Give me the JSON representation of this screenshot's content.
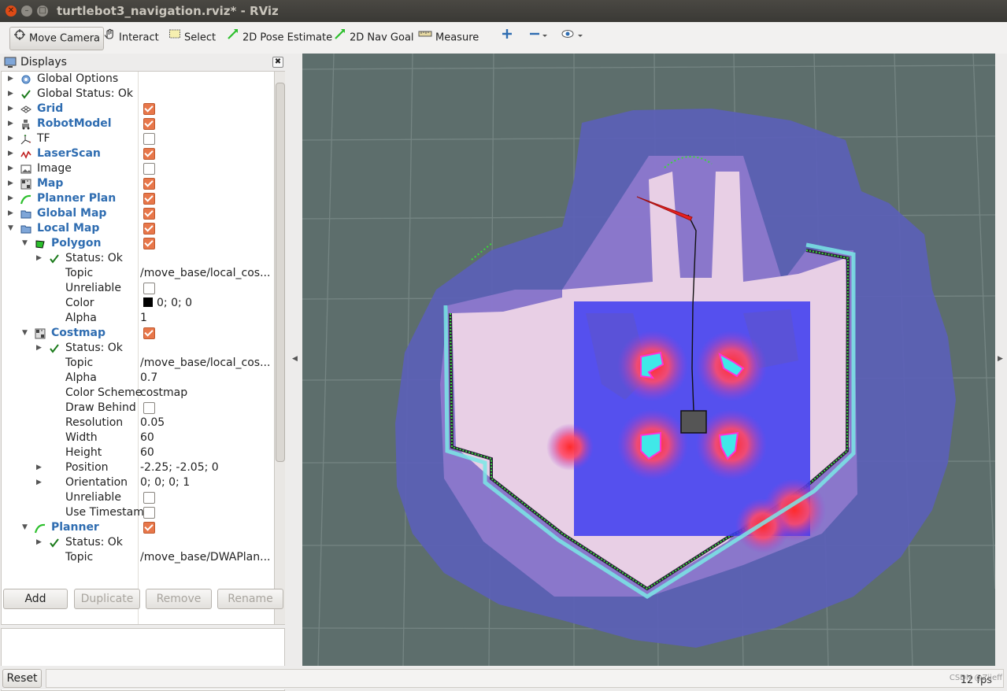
{
  "window": {
    "title": "turtlebot3_navigation.rviz* - RViz"
  },
  "toolbar": {
    "move_camera": "Move Camera",
    "interact": "Interact",
    "select": "Select",
    "pose_estimate": "2D Pose Estimate",
    "nav_goal": "2D Nav Goal",
    "measure": "Measure"
  },
  "displays": {
    "title": "Displays",
    "rows": [
      {
        "indent": 0,
        "arrow": "right",
        "icon": "gear-icon",
        "name": "Global Options",
        "blue": false,
        "check": null,
        "value": ""
      },
      {
        "indent": 0,
        "arrow": "right",
        "icon": "check-icon",
        "name": "Global Status: Ok",
        "blue": false,
        "check": null,
        "value": ""
      },
      {
        "indent": 0,
        "arrow": "right",
        "icon": "grid-icon",
        "name": "Grid",
        "blue": true,
        "check": true,
        "value": ""
      },
      {
        "indent": 0,
        "arrow": "right",
        "icon": "robot-icon",
        "name": "RobotModel",
        "blue": true,
        "check": true,
        "value": ""
      },
      {
        "indent": 0,
        "arrow": "right",
        "icon": "tf-icon",
        "name": "TF",
        "blue": false,
        "check": false,
        "value": ""
      },
      {
        "indent": 0,
        "arrow": "right",
        "icon": "laser-icon",
        "name": "LaserScan",
        "blue": true,
        "check": true,
        "value": ""
      },
      {
        "indent": 0,
        "arrow": "right",
        "icon": "image-icon",
        "name": "Image",
        "blue": false,
        "check": false,
        "value": ""
      },
      {
        "indent": 0,
        "arrow": "right",
        "icon": "map-icon",
        "name": "Map",
        "blue": true,
        "check": true,
        "value": ""
      },
      {
        "indent": 0,
        "arrow": "right",
        "icon": "path-icon",
        "name": "Planner Plan",
        "blue": true,
        "check": true,
        "value": ""
      },
      {
        "indent": 0,
        "arrow": "right",
        "icon": "folder-icon",
        "name": "Global Map",
        "blue": true,
        "check": true,
        "value": ""
      },
      {
        "indent": 0,
        "arrow": "down",
        "icon": "folder-icon",
        "name": "Local Map",
        "blue": true,
        "check": true,
        "value": ""
      },
      {
        "indent": 1,
        "arrow": "down",
        "icon": "polygon-icon",
        "name": "Polygon",
        "blue": true,
        "check": true,
        "value": ""
      },
      {
        "indent": 2,
        "arrow": "right",
        "icon": "check-icon",
        "name": "Status: Ok",
        "blue": false,
        "check": null,
        "value": ""
      },
      {
        "indent": 2,
        "arrow": "",
        "icon": "",
        "name": "Topic",
        "blue": false,
        "check": null,
        "value": "/move_base/local_cos..."
      },
      {
        "indent": 2,
        "arrow": "",
        "icon": "",
        "name": "Unreliable",
        "blue": false,
        "check": false,
        "value": ""
      },
      {
        "indent": 2,
        "arrow": "",
        "icon": "",
        "name": "Color",
        "blue": false,
        "check": null,
        "value": "0; 0; 0",
        "swatch": "#000000"
      },
      {
        "indent": 2,
        "arrow": "",
        "icon": "",
        "name": "Alpha",
        "blue": false,
        "check": null,
        "value": "1"
      },
      {
        "indent": 1,
        "arrow": "down",
        "icon": "map-icon",
        "name": "Costmap",
        "blue": true,
        "check": true,
        "value": ""
      },
      {
        "indent": 2,
        "arrow": "right",
        "icon": "check-icon",
        "name": "Status: Ok",
        "blue": false,
        "check": null,
        "value": ""
      },
      {
        "indent": 2,
        "arrow": "",
        "icon": "",
        "name": "Topic",
        "blue": false,
        "check": null,
        "value": "/move_base/local_cos..."
      },
      {
        "indent": 2,
        "arrow": "",
        "icon": "",
        "name": "Alpha",
        "blue": false,
        "check": null,
        "value": "0.7"
      },
      {
        "indent": 2,
        "arrow": "",
        "icon": "",
        "name": "Color Scheme",
        "blue": false,
        "check": null,
        "value": "costmap"
      },
      {
        "indent": 2,
        "arrow": "",
        "icon": "",
        "name": "Draw Behind",
        "blue": false,
        "check": false,
        "value": ""
      },
      {
        "indent": 2,
        "arrow": "",
        "icon": "",
        "name": "Resolution",
        "blue": false,
        "check": null,
        "value": "0.05"
      },
      {
        "indent": 2,
        "arrow": "",
        "icon": "",
        "name": "Width",
        "blue": false,
        "check": null,
        "value": "60"
      },
      {
        "indent": 2,
        "arrow": "",
        "icon": "",
        "name": "Height",
        "blue": false,
        "check": null,
        "value": "60"
      },
      {
        "indent": 2,
        "arrow": "right",
        "icon": "",
        "name": "Position",
        "blue": false,
        "check": null,
        "value": "-2.25; -2.05; 0"
      },
      {
        "indent": 2,
        "arrow": "right",
        "icon": "",
        "name": "Orientation",
        "blue": false,
        "check": null,
        "value": "0; 0; 0; 1"
      },
      {
        "indent": 2,
        "arrow": "",
        "icon": "",
        "name": "Unreliable",
        "blue": false,
        "check": false,
        "value": ""
      },
      {
        "indent": 2,
        "arrow": "",
        "icon": "",
        "name": "Use Timestamp",
        "blue": false,
        "check": false,
        "value": ""
      },
      {
        "indent": 1,
        "arrow": "down",
        "icon": "path-icon",
        "name": "Planner",
        "blue": true,
        "check": true,
        "value": ""
      },
      {
        "indent": 2,
        "arrow": "right",
        "icon": "check-icon",
        "name": "Status: Ok",
        "blue": false,
        "check": null,
        "value": ""
      },
      {
        "indent": 2,
        "arrow": "",
        "icon": "",
        "name": "Topic",
        "blue": false,
        "check": null,
        "value": "/move_base/DWAPlan..."
      }
    ]
  },
  "buttons": {
    "add": "Add",
    "duplicate": "Duplicate",
    "remove": "Remove",
    "rename": "Rename"
  },
  "statusbar": {
    "reset": "Reset",
    "fps": "12 fps",
    "watermark": "CSDN @Zijeff"
  }
}
